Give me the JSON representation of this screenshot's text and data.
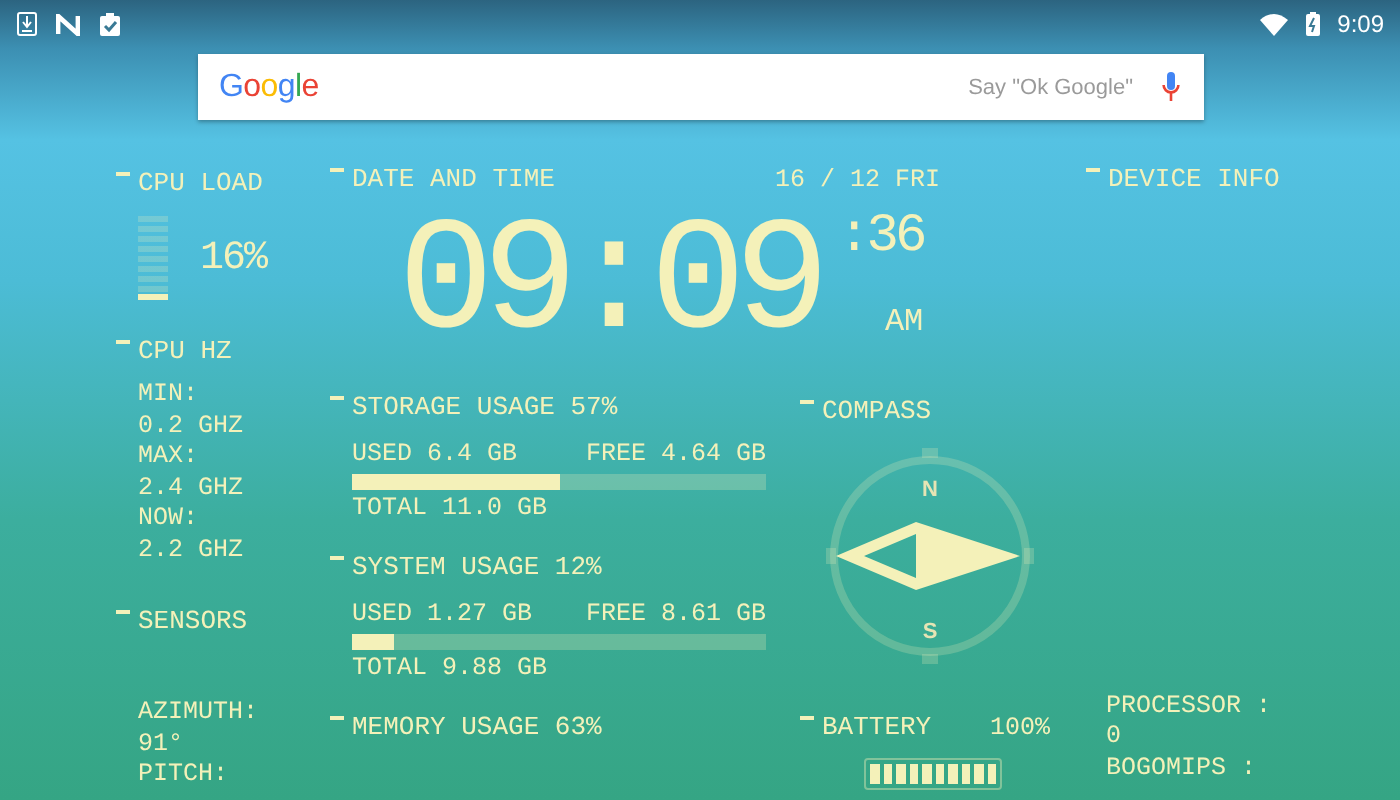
{
  "status_bar": {
    "time": "9:09"
  },
  "search": {
    "logo": "Google",
    "placeholder": "Say \"Ok Google\""
  },
  "cpu_load": {
    "title": "CPU LOAD",
    "level": 0.16,
    "reading": "16%"
  },
  "cpu_hz": {
    "title": "CPU HZ",
    "lines": [
      "MIN:",
      "0.2 GHZ",
      "MAX:",
      "2.4 GHZ",
      "NOW:",
      "2.2 GHZ"
    ]
  },
  "sensors": {
    "title": "SENSORS",
    "lines": [
      "AZIMUTH:",
      "91°",
      "PITCH:"
    ]
  },
  "date_time": {
    "title": "DATE AND TIME",
    "date": "16 / 12 FRI",
    "hours_minutes": "09:09",
    "seconds": ":36",
    "period": "AM"
  },
  "usage": [
    {
      "title": "STORAGE USAGE 57%",
      "used": "USED 6.4 GB",
      "free": "FREE 4.64 GB",
      "level": 0.5,
      "total": "TOTAL 11.0 GB"
    },
    {
      "title": "SYSTEM USAGE 12%",
      "used": "USED 1.27 GB",
      "free": "FREE 8.61 GB",
      "level": 0.1,
      "total": "TOTAL 9.88 GB"
    },
    {
      "title": "MEMORY USAGE 63%"
    }
  ],
  "compass": {
    "title": "COMPASS",
    "north": "N",
    "south": "S"
  },
  "battery": {
    "title": "BATTERY",
    "reading": "100%",
    "level": 1
  },
  "device_info": {
    "title": "DEVICE INFO",
    "lines": [
      "PROCESSOR :",
      "0",
      "BOGOMIPS :"
    ]
  }
}
